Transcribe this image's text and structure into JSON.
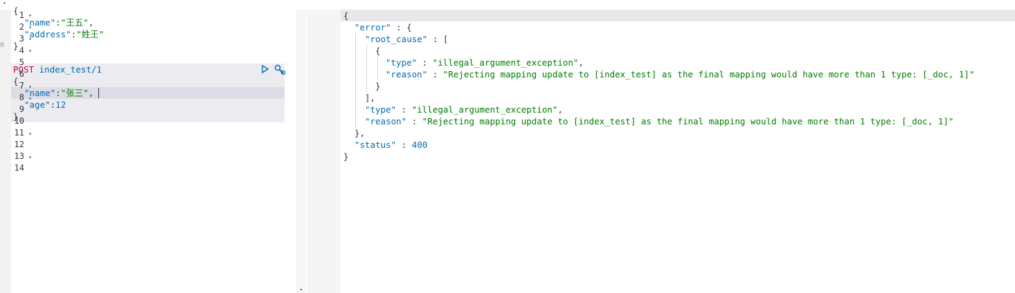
{
  "top": {
    "fragment": "",
    "fold_arrow": "▾"
  },
  "left": {
    "gutter_marks": [
      "0",
      "",
      "",
      "",
      "",
      "",
      "",
      "",
      "",
      "",
      "",
      "",
      "",
      "",
      "",
      "",
      "",
      "",
      "",
      "",
      "",
      "",
      "",
      "",
      ""
    ],
    "doc": {
      "open": "{",
      "name_key": "\"name\"",
      "colon": ":",
      "name_val": "\"王五\"",
      "comma": ",",
      "address_key": "\"address\"",
      "address_val": "\"姓王\"",
      "close": "}"
    },
    "request": {
      "method": "POST",
      "path": "index_test/1",
      "open": "{",
      "name_key": "\"name\"",
      "name_val": "\"张三\"",
      "age_key": "\"age\"",
      "age_val": "12",
      "close": "}"
    },
    "actions": {
      "run_icon": "play-icon",
      "settings_icon": "wrench-icon"
    }
  },
  "right": {
    "line_numbers": [
      "1",
      "2",
      "3",
      "4",
      "5",
      "6",
      "7",
      "8",
      "9",
      "10",
      "11",
      "12",
      "13",
      "14"
    ],
    "fold": [
      "▾",
      "▾",
      "▾",
      "▾",
      "",
      "",
      "▴",
      "▴",
      "",
      "",
      "▴",
      "",
      "▴",
      ""
    ],
    "lines": {
      "l1": "{",
      "l2_key": "\"error\"",
      "l2_rest": " : {",
      "l3_key": "\"root_cause\"",
      "l3_rest": " : [",
      "l4": "{",
      "l5_key": "\"type\"",
      "l5_sep": " : ",
      "l5_val": "\"illegal_argument_exception\"",
      "l5_end": ",",
      "l6_key": "\"reason\"",
      "l6_sep": " : ",
      "l6_val": "\"Rejecting mapping update to [index_test] as the final mapping would have more than 1 type: [_doc, 1]\"",
      "l7": "}",
      "l8": "],",
      "l9_key": "\"type\"",
      "l9_sep": " : ",
      "l9_val": "\"illegal_argument_exception\"",
      "l9_end": ",",
      "l10_key": "\"reason\"",
      "l10_sep": " : ",
      "l10_val": "\"Rejecting mapping update to [index_test] as the final mapping would have more than 1 type: [_doc, 1]\"",
      "l11": "},",
      "l12_key": "\"status\"",
      "l12_sep": " : ",
      "l12_val": "400",
      "l13": "}"
    }
  }
}
